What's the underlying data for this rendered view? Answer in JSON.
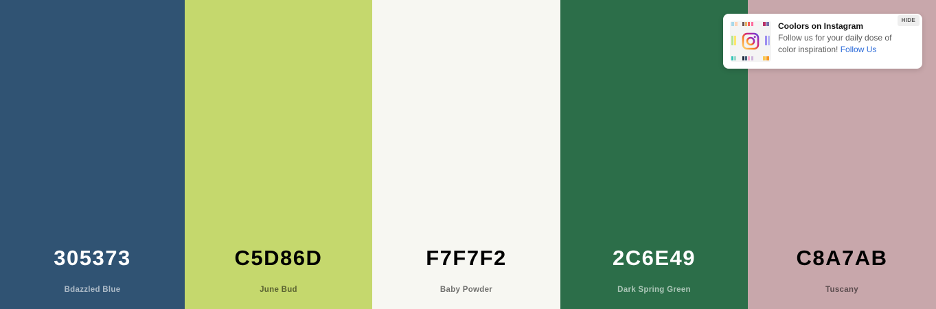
{
  "palette": {
    "colors": [
      {
        "hex": "305373",
        "name": "Bdazzled Blue",
        "color": "#305373",
        "text_theme": "dark"
      },
      {
        "hex": "C5D86D",
        "name": "June Bud",
        "color": "#C5D86D",
        "text_theme": "light"
      },
      {
        "hex": "F7F7F2",
        "name": "Baby Powder",
        "color": "#F7F7F2",
        "text_theme": "light"
      },
      {
        "hex": "2C6E49",
        "name": "Dark Spring Green",
        "color": "#2C6E49",
        "text_theme": "dark"
      },
      {
        "hex": "C8A7AB",
        "name": "Tuscany",
        "color": "#C8A7AB",
        "text_theme": "light"
      }
    ]
  },
  "promo": {
    "title": "Coolors on Instagram",
    "body": "Follow us for your daily dose of color inspiration!",
    "follow_label": "Follow Us",
    "hide_label": "HIDE",
    "icon": "instagram-icon"
  }
}
